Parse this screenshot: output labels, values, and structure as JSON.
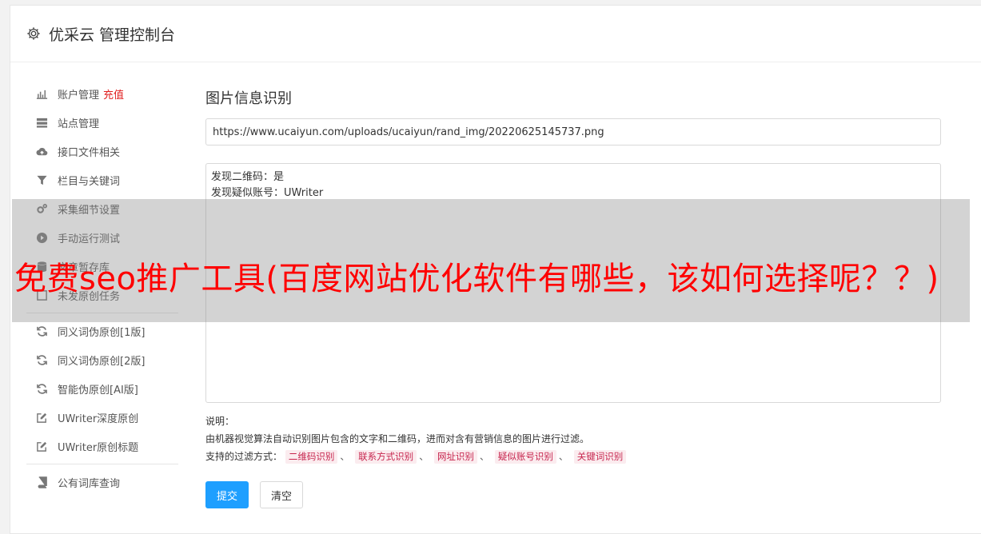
{
  "header": {
    "icon": "gear-icon",
    "title": "优采云 管理控制台"
  },
  "sidebar": {
    "items": [
      {
        "icon": "bar-chart-icon",
        "label": "账户管理",
        "badge": "充值"
      },
      {
        "icon": "server-icon",
        "label": "站点管理"
      },
      {
        "icon": "cloud-upload-icon",
        "label": "接口文件相关"
      },
      {
        "icon": "filter-icon",
        "label": "栏目与关键词"
      },
      {
        "icon": "gears-icon",
        "label": "采集细节设置"
      },
      {
        "icon": "play-circle-icon",
        "label": "手动运行测试"
      },
      {
        "icon": "database-icon",
        "label": "文章暂存库"
      },
      {
        "icon": "list-icon",
        "label": "未发原创任务"
      }
    ],
    "items2": [
      {
        "icon": "refresh-icon",
        "label": "同义词伪原创[1版]"
      },
      {
        "icon": "refresh-icon",
        "label": "同义词伪原创[2版]"
      },
      {
        "icon": "refresh-icon",
        "label": "智能伪原创[AI版]"
      },
      {
        "icon": "edit-icon",
        "label": "UWriter深度原创"
      },
      {
        "icon": "edit-icon",
        "label": "UWriter原创标题"
      }
    ],
    "items3": [
      {
        "icon": "book-icon",
        "label": "公有词库查询"
      }
    ]
  },
  "main": {
    "title": "图片信息识别",
    "url_value": "https://www.ucaiyun.com/uploads/ucaiyun/rand_img/20220625145737.png",
    "result_line1": "发现二维码：是",
    "result_line2": "发现疑似账号：UWriter",
    "desc_label": "说明：",
    "desc_text": "由机器视觉算法自动识别图片包含的文字和二维码，进而对含有营销信息的图片进行过滤。",
    "filters_label": "支持的过滤方式：",
    "filters": [
      "二维码识别",
      "联系方式识别",
      "网址识别",
      "疑似账号识别",
      "关键词识别"
    ],
    "submit_label": "提交",
    "clear_label": "清空"
  },
  "overlay": {
    "text": "免费seo推广工具(百度网站优化软件有哪些，该如何选择呢？？)"
  }
}
